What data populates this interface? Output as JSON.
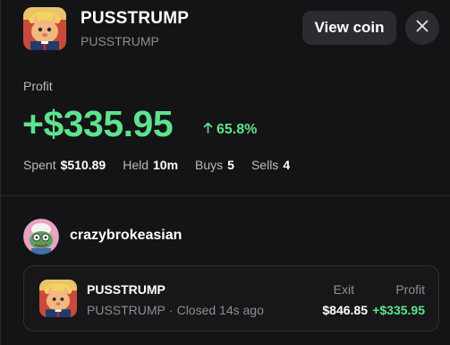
{
  "coin": {
    "name": "PUSSTRUMP",
    "ticker": "PUSSTRUMP",
    "avatar_icon": "cat-trump-avatar"
  },
  "header": {
    "view_coin_label": "View coin",
    "close_icon": "close-icon"
  },
  "profit": {
    "label": "Profit",
    "amount": "+$335.95",
    "percent": "65.8%",
    "percent_icon": "arrow-up-icon"
  },
  "stats": {
    "spent_label": "Spent",
    "spent_value": "$510.89",
    "held_label": "Held",
    "held_value": "10m",
    "buys_label": "Buys",
    "buys_value": "5",
    "sells_label": "Sells",
    "sells_value": "4"
  },
  "user": {
    "name": "crazybrokeasian",
    "avatar_icon": "pepe-avatar"
  },
  "trade": {
    "name": "PUSSTRUMP",
    "ticker": "PUSSTRUMP",
    "separator": "·",
    "status": "Closed 14s ago",
    "exit_label": "Exit",
    "exit_value": "$846.85",
    "profit_label": "Profit",
    "profit_value": "+$335.95"
  },
  "colors": {
    "background": "#141416",
    "profit_green": "#5ee38d",
    "muted_text": "#8d8d93",
    "button_bg": "#2c2c30"
  }
}
